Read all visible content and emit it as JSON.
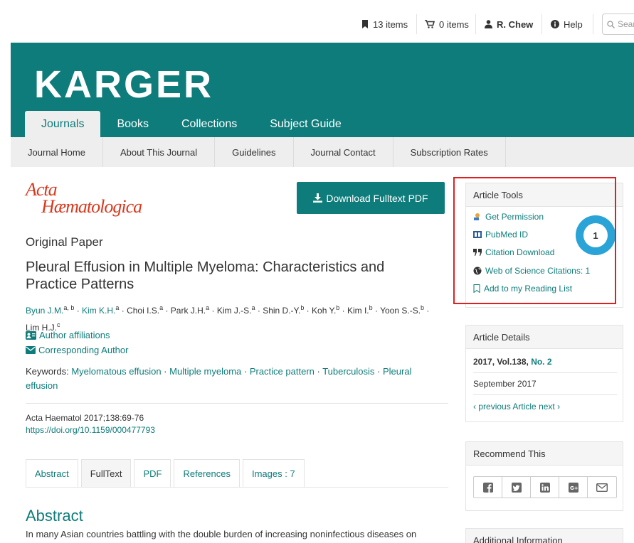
{
  "topbar": {
    "reading_list": "13 items",
    "cart": "0 items",
    "user": "R. Chew",
    "help": "Help",
    "search_placeholder": "Sear"
  },
  "brand": {
    "logo": "KARGER"
  },
  "main_nav": [
    "Journals",
    "Books",
    "Collections",
    "Subject Guide"
  ],
  "sub_nav": [
    "Journal Home",
    "About This Journal",
    "Guidelines",
    "Journal Contact",
    "Subscription Rates"
  ],
  "journal_logo": {
    "line1": "Acta",
    "line2": "Hæmatologica"
  },
  "download_button": "Download Fulltext PDF",
  "paper_type": "Original Paper",
  "title": "Pleural Effusion in Multiple Myeloma: Characteristics and Practice Patterns",
  "authors": [
    {
      "name": "Byun J.M.",
      "sup": "a, b"
    },
    {
      "name": "Kim K.H.",
      "sup": "a"
    },
    {
      "name": "Choi I.S.",
      "sup": "a"
    },
    {
      "name": "Park J.H.",
      "sup": "a"
    },
    {
      "name": "Kim J.-S.",
      "sup": "a"
    },
    {
      "name": "Shin D.-Y.",
      "sup": "b"
    },
    {
      "name": "Koh Y.",
      "sup": "b"
    },
    {
      "name": "Kim I.",
      "sup": "b"
    },
    {
      "name": "Yoon S.-S.",
      "sup": "b"
    },
    {
      "name": "Lim H.J.",
      "sup": "c"
    }
  ],
  "author_affiliations": "Author affiliations",
  "corresponding_author": "Corresponding Author",
  "keywords_label": "Keywords:",
  "keywords": [
    "Myelomatous effusion",
    "Multiple myeloma",
    "Practice pattern",
    "Tuberculosis",
    "Pleural effusion"
  ],
  "citation": "Acta Haematol 2017;138:69-76",
  "doi": "https://doi.org/10.1159/000477793",
  "tabs": [
    "Abstract",
    "FullText",
    "PDF",
    "References",
    "Images : 7"
  ],
  "abstract_heading": "Abstract",
  "abstract_text": "In many Asian countries battling with the double burden of increasing noninfectious diseases on",
  "sidebar": {
    "tools_title": "Article Tools",
    "tools": [
      "Get Permission",
      "PubMed ID",
      "Citation Download",
      "Web of Science Citations: 1",
      "Add to my Reading List"
    ],
    "badge_value": "1",
    "details_title": "Article Details",
    "details_year_vol": "2017, Vol.138,",
    "details_issue": "No. 2",
    "details_date": "September 2017",
    "details_prev": "previous Article",
    "details_next": "next",
    "recommend_title": "Recommend This",
    "additional_title": "Additional Information"
  },
  "colors": {
    "brand": "#0e7c7b",
    "highlight": "#e02020",
    "badge": "#2aa3d6"
  }
}
